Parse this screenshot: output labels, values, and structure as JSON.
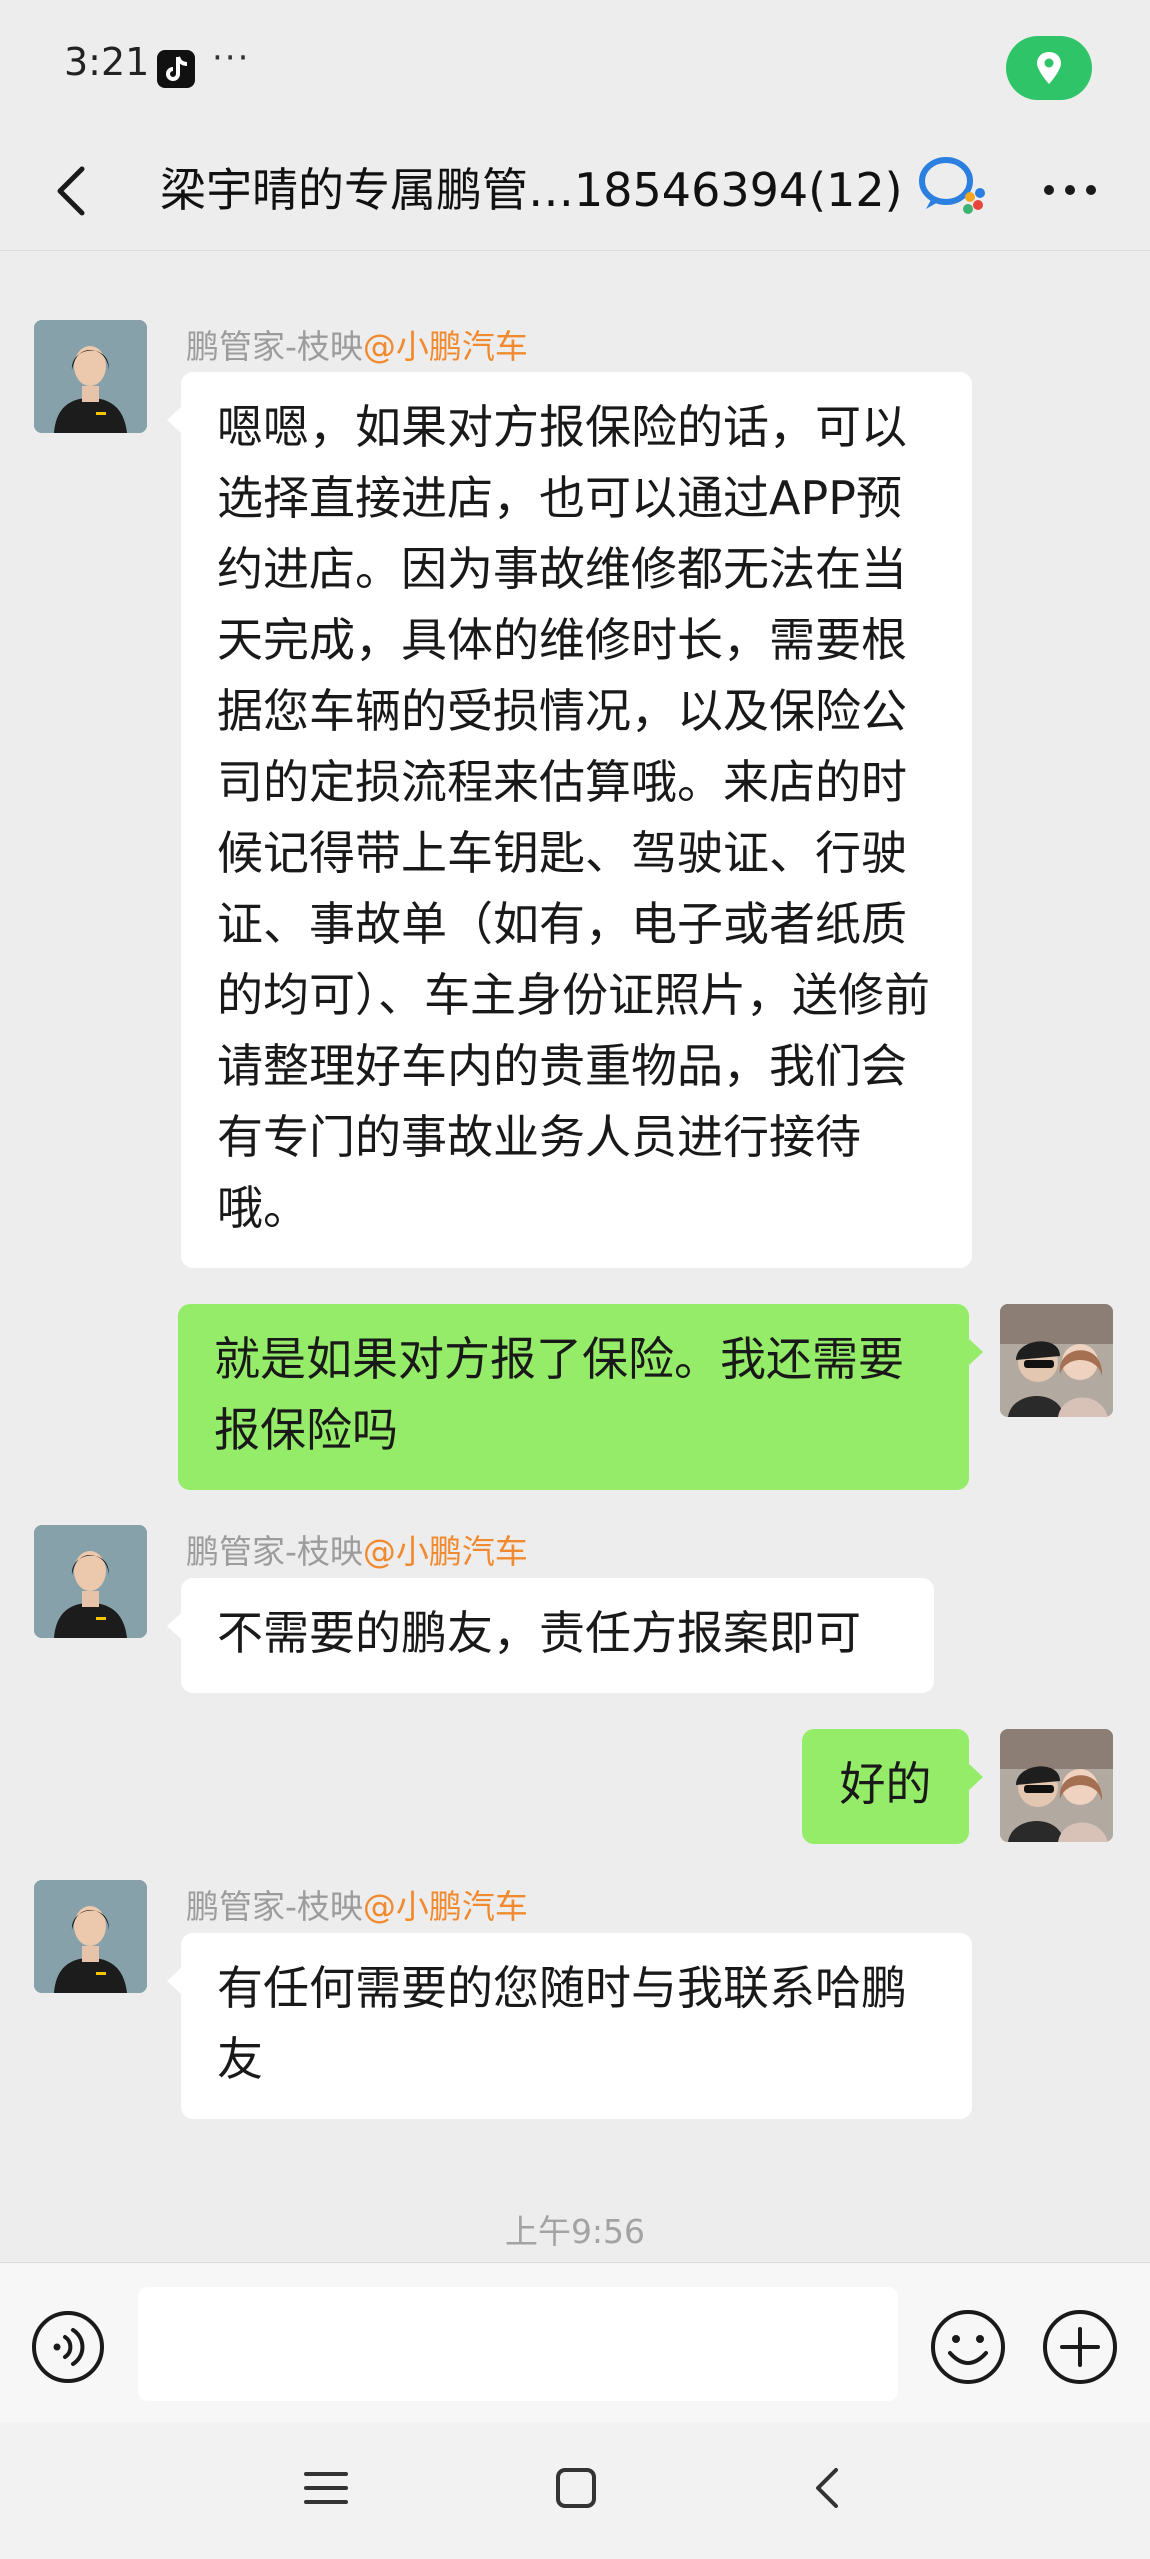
{
  "status_bar": {
    "time": "3:21",
    "more": "···",
    "icons": [
      "tiktok-icon",
      "location-icon"
    ],
    "location_color": "#2fc468"
  },
  "header": {
    "title": "梁宇晴的专属鹏管…18546394(12)",
    "icons": [
      "back-icon",
      "wecom-icon",
      "more-icon"
    ]
  },
  "messages": [
    {
      "side": "in",
      "sender": "鹏管家-枝映",
      "org": "@小鹏汽车",
      "text": "嗯嗯，如果对方报保险的话，可以选择直接进店，也可以通过APP预约进店。因为事故维修都无法在当天完成，具体的维修时长，需要根据您车辆的受损情况，以及保险公司的定损流程来估算哦。来店的时候记得带上车钥匙、驾驶证、行驶证、事故单（如有，电子或者纸质的均可）、车主身份证照片，送修前请整理好车内的贵重物品，我们会有专门的事故业务人员进行接待哦。"
    },
    {
      "side": "out",
      "text": "就是如果对方报了保险。我还需要报保险吗"
    },
    {
      "side": "in",
      "sender": "鹏管家-枝映",
      "org": "@小鹏汽车",
      "text": "不需要的鹏友，责任方报案即可"
    },
    {
      "side": "out",
      "text": "好的"
    },
    {
      "side": "in",
      "sender": "鹏管家-枝映",
      "org": "@小鹏汽车",
      "text": "有任何需要的您随时与我联系哈鹏友"
    }
  ],
  "timestamp": "上午9:56",
  "input_bar": {
    "value": "",
    "icons": [
      "voice-icon",
      "emoji-icon",
      "plus-icon"
    ]
  },
  "nav_bar": {
    "icons": [
      "menu-icon",
      "home-icon",
      "back-nav-icon"
    ]
  },
  "colors": {
    "background": "#ededed",
    "bubble_in": "#ffffff",
    "bubble_out": "#95ec69",
    "org_label": "#f18a2e"
  }
}
